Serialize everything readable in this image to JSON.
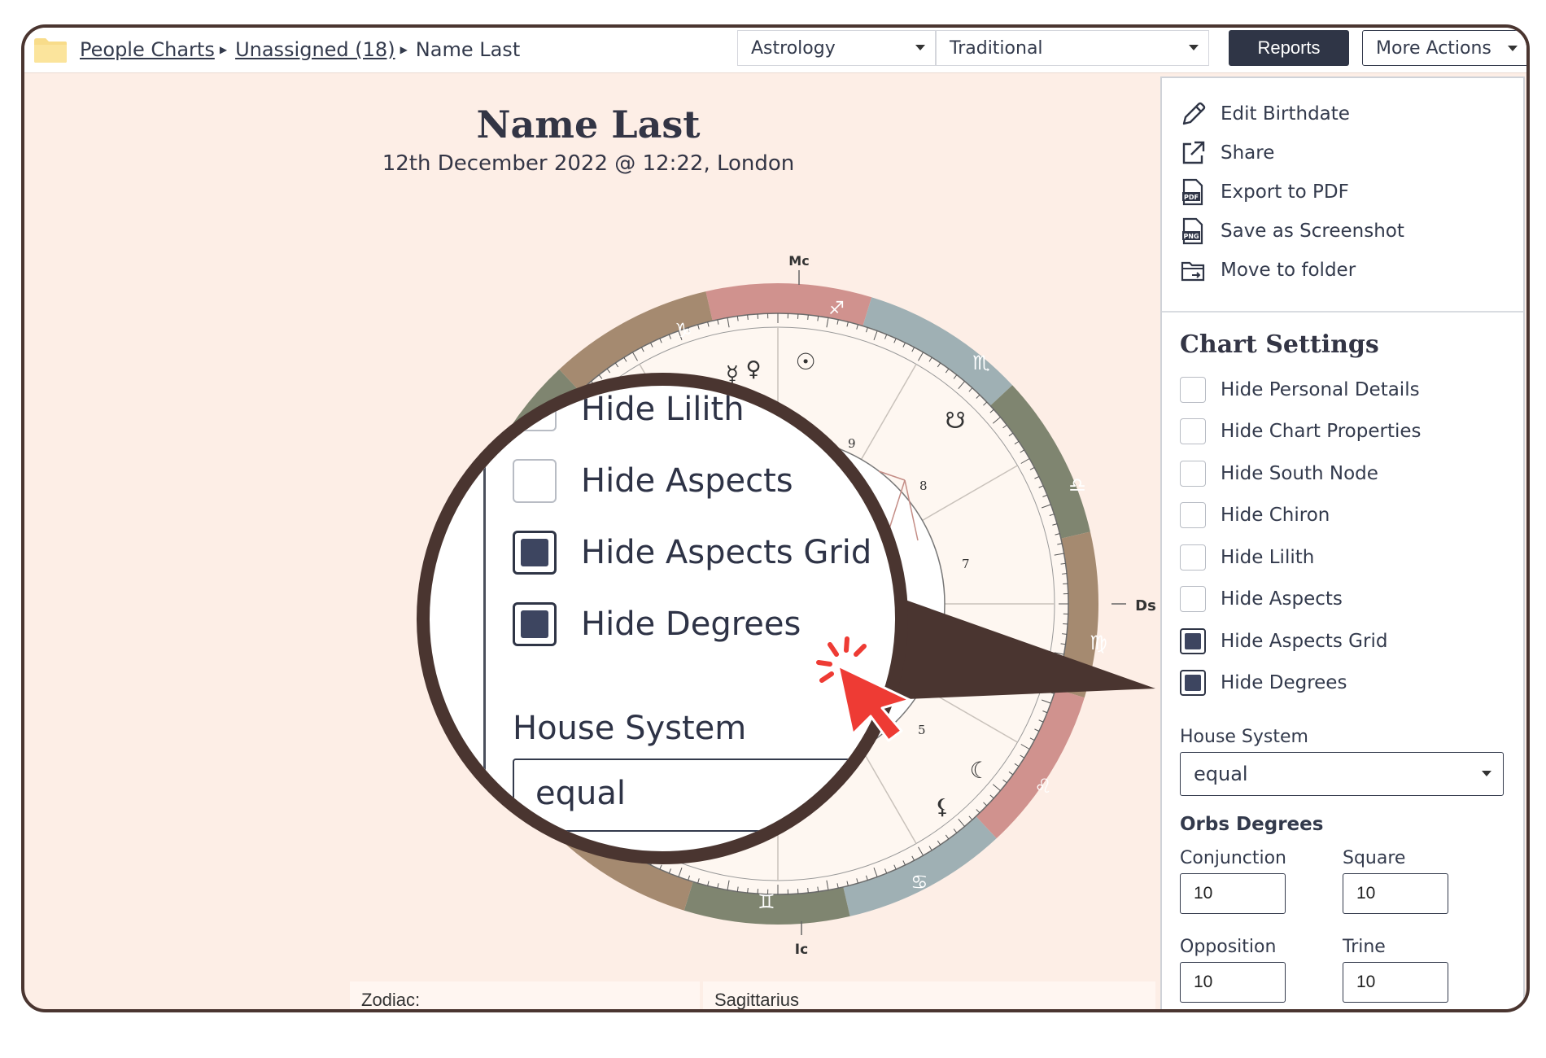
{
  "breadcrumb": {
    "items": [
      "People Charts",
      "Unassigned (18)"
    ],
    "current": "Name Last"
  },
  "toolbar": {
    "category_select": "Astrology",
    "style_select": "Traditional",
    "reports_label": "Reports",
    "more_actions_label": "More Actions"
  },
  "chart": {
    "title": "Name Last",
    "subtitle": "12th December 2022 @ 12:22, London",
    "angles": {
      "mc": "Mc",
      "ic": "Ic",
      "ds": "Ds"
    },
    "house_numbers": [
      "9",
      "8",
      "7",
      "5"
    ],
    "signs": {
      "sagittarius": "♐",
      "capricorn": "♑",
      "scorpio": "♏",
      "libra": "♎",
      "virgo": "♍",
      "leo": "♌",
      "cancer": "♋",
      "gemini": "♊"
    },
    "planets": {
      "mercury": "☿",
      "venus": "♀",
      "sun": "☉",
      "node": "☋",
      "moon": "☾",
      "lilith": "⚸"
    },
    "segment_colors": {
      "rose": "#d0928e",
      "grey_blue": "#9fb0b4",
      "olive": "#7f8570",
      "tan": "#a58a70"
    }
  },
  "info": {
    "label": "Zodiac:",
    "value": "Sagittarius"
  },
  "sidebar": {
    "actions": [
      {
        "label": "Edit Birthdate",
        "icon": "pencil-icon"
      },
      {
        "label": "Share",
        "icon": "share-icon"
      },
      {
        "label": "Export to PDF",
        "icon": "pdf-file-icon",
        "badge": "PDF"
      },
      {
        "label": "Save as Screenshot",
        "icon": "png-file-icon",
        "badge": "PNG"
      },
      {
        "label": "Move to folder",
        "icon": "folder-move-icon"
      }
    ],
    "settings_title": "Chart Settings",
    "checkboxes": [
      {
        "label": "Hide Personal Details",
        "checked": false
      },
      {
        "label": "Hide Chart Properties",
        "checked": false
      },
      {
        "label": "Hide South Node",
        "checked": false
      },
      {
        "label": "Hide Chiron",
        "checked": false
      },
      {
        "label": "Hide Lilith",
        "checked": false
      },
      {
        "label": "Hide Aspects",
        "checked": false
      },
      {
        "label": "Hide Aspects Grid",
        "checked": true
      },
      {
        "label": "Hide Degrees",
        "checked": true
      }
    ],
    "house_system_label": "House System",
    "house_system_value": "equal",
    "orbs_title": "Orbs Degrees",
    "orbs": [
      {
        "label": "Conjunction",
        "value": "10"
      },
      {
        "label": "Square",
        "value": "10"
      },
      {
        "label": "Opposition",
        "value": "10"
      },
      {
        "label": "Trine",
        "value": "10"
      }
    ]
  },
  "magnifier": {
    "rows": [
      {
        "label": "Hide Lilith",
        "checked": false
      },
      {
        "label": "Hide Aspects",
        "checked": false
      },
      {
        "label": "Hide Aspects Grid",
        "checked": true
      },
      {
        "label": "Hide Degrees",
        "checked": true
      }
    ],
    "house_label": "House System",
    "house_value": "equal"
  },
  "colors": {
    "accent_dark": "#2f3546",
    "frame": "#4a3530",
    "background": "#fdeee6",
    "cursor_red": "#ee3b34"
  }
}
